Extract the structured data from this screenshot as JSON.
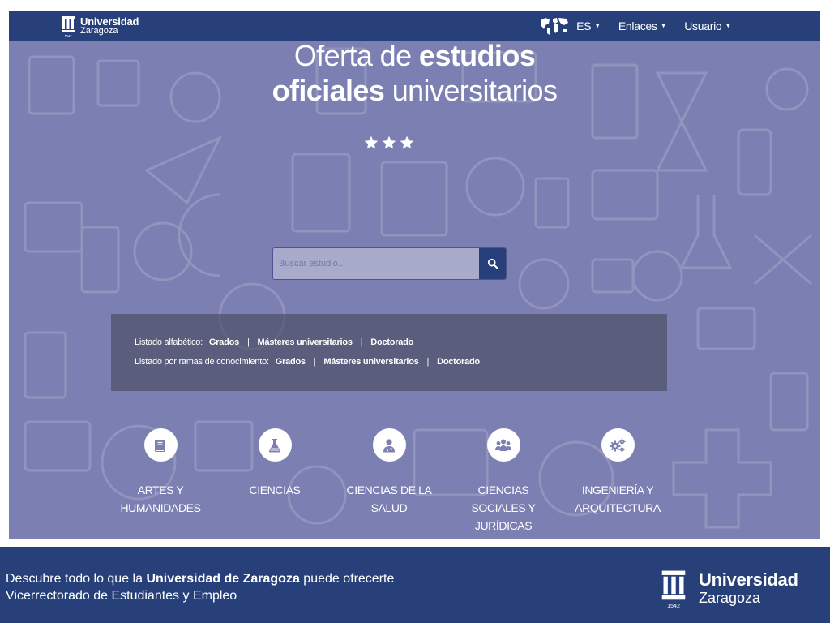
{
  "header": {
    "logo": {
      "line1": "Universidad",
      "line2": "Zaragoza",
      "year": "1542"
    },
    "nav": {
      "language": "ES",
      "links": "Enlaces",
      "user": "Usuario"
    }
  },
  "hero": {
    "title_line1_regular": "Oferta de",
    "title_line1_bold": "estudios",
    "title_line2_bold": "oficiales",
    "title_line2_regular": "universitarios",
    "stars": 3
  },
  "search": {
    "placeholder": "Buscar estudio..."
  },
  "listing": {
    "alphabetical": {
      "label": "Listado alfabético:",
      "links": [
        "Grados",
        "Másteres universitarios",
        "Doctorado"
      ],
      "separator": "|"
    },
    "by_branch": {
      "label": "Listado por ramas de conocimiento:",
      "links": [
        "Grados",
        "Másteres universitarios",
        "Doctorado"
      ],
      "separator": "|"
    }
  },
  "categories": [
    {
      "name": "ARTES Y\nHUMANIDADES",
      "icon": "book-icon"
    },
    {
      "name": "CIENCIAS",
      "icon": "flask-icon"
    },
    {
      "name": "CIENCIAS DE LA\nSALUD",
      "icon": "doctor-icon"
    },
    {
      "name": "CIENCIAS\nSOCIALES Y\nJURÍDICAS",
      "icon": "people-icon"
    },
    {
      "name": "INGENIERÍA Y\nARQUITECTURA",
      "icon": "gears-icon"
    }
  ],
  "footer": {
    "line1_start": "Descubre todo lo que la",
    "line1_bold": "Universidad de Zaragoza",
    "line1_end": "puede ofrecerte",
    "line2": "Vicerrectorado de Estudiantes y Empleo",
    "logo": {
      "line1": "Universidad",
      "line2": "Zaragoza",
      "year": "1542"
    }
  },
  "colors": {
    "navy": "#27407a",
    "page_background": "#7c7fb1",
    "panel": "#46485c",
    "icon_foreground": "#7c7fb1"
  }
}
